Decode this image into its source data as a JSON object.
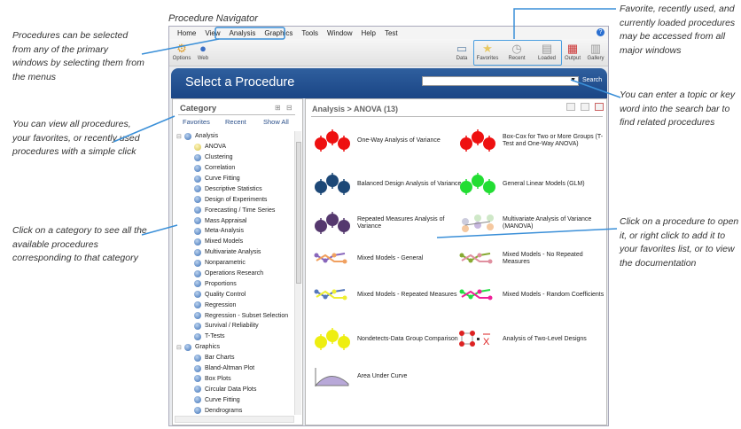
{
  "annotations": {
    "navigator_label": "Procedure Navigator",
    "menus": "Procedures can be selected from any of the primary windows by selecting them from the menus",
    "views": "You can view all procedures, your favorites, or recently used procedures with a simple click",
    "category": "Click on a category to see all the available procedures corresponding to that category",
    "favorites": "Favorite, recently used, and currently loaded procedures may be accessed from all major windows",
    "search": "You can enter a topic or key word into the search bar to find related procedures",
    "procedure": "Click on a procedure to open it, or right click to add it to your favorites list, or to view the documentation"
  },
  "menu": [
    "Home",
    "View",
    "Analysis",
    "Graphics",
    "Tools",
    "Window",
    "Help",
    "Test"
  ],
  "toolbar": {
    "options": "Options",
    "web": "Web",
    "data": "Data",
    "favorites": "Favorites",
    "recent": "Recent",
    "loaded": "Loaded",
    "output": "Output",
    "gallery": "Gallery"
  },
  "header": {
    "title": "Select a Procedure",
    "search_value": "",
    "search_button": "Search"
  },
  "category": {
    "title": "Category",
    "links": [
      "Favorites",
      "Recent",
      "Show All"
    ],
    "tree": [
      {
        "label": "Analysis",
        "level": 0
      },
      {
        "label": "ANOVA",
        "level": 1,
        "selected": true
      },
      {
        "label": "Clustering",
        "level": 1
      },
      {
        "label": "Correlation",
        "level": 1
      },
      {
        "label": "Curve Fitting",
        "level": 1
      },
      {
        "label": "Descriptive Statistics",
        "level": 1
      },
      {
        "label": "Design of Experiments",
        "level": 1
      },
      {
        "label": "Forecasting / Time Series",
        "level": 1
      },
      {
        "label": "Mass Appraisal",
        "level": 1
      },
      {
        "label": "Meta-Analysis",
        "level": 1
      },
      {
        "label": "Mixed Models",
        "level": 1
      },
      {
        "label": "Multivariate Analysis",
        "level": 1
      },
      {
        "label": "Nonparametric",
        "level": 1
      },
      {
        "label": "Operations Research",
        "level": 1
      },
      {
        "label": "Proportions",
        "level": 1
      },
      {
        "label": "Quality Control",
        "level": 1
      },
      {
        "label": "Regression",
        "level": 1
      },
      {
        "label": "Regression - Subset Selection",
        "level": 1
      },
      {
        "label": "Survival / Reliability",
        "level": 1
      },
      {
        "label": "T-Tests",
        "level": 1
      },
      {
        "label": "Graphics",
        "level": 0
      },
      {
        "label": "Bar Charts",
        "level": 1
      },
      {
        "label": "Bland-Altman Plot",
        "level": 1
      },
      {
        "label": "Box Plots",
        "level": 1
      },
      {
        "label": "Circular Data Plots",
        "level": 1
      },
      {
        "label": "Curve Fitting",
        "level": 1
      },
      {
        "label": "Dendrograms",
        "level": 1
      }
    ]
  },
  "main": {
    "breadcrumb": "Analysis > ANOVA (13)",
    "procedures": [
      {
        "label": "One-Way Analysis of Variance",
        "icon": "dots",
        "color": "#ee1111"
      },
      {
        "label": "Box-Cox for Two or More Groups (T-Test and One-Way ANOVA)",
        "icon": "dots",
        "color": "#ee1111"
      },
      {
        "label": "Balanced Design Analysis of Variance",
        "icon": "dots",
        "color": "#1d4877"
      },
      {
        "label": "General Linear Models (GLM)",
        "icon": "dots",
        "color": "#22dd33"
      },
      {
        "label": "Repeated Measures Analysis of Variance",
        "icon": "dots",
        "color": "#55386e"
      },
      {
        "label": "Multivariate Analysis of Variance (MANOVA)",
        "icon": "manova",
        "color": "#c8b8e0"
      },
      {
        "label": "Mixed Models - General",
        "icon": "lines",
        "color": "#8866bb",
        "color2": "#f0a060"
      },
      {
        "label": "Mixed Models - No Repeated Measures",
        "icon": "lines",
        "color": "#88aa33",
        "color2": "#e090a0"
      },
      {
        "label": "Mixed Models - Repeated Measures",
        "icon": "lines",
        "color": "#5577bb",
        "color2": "#eeee33"
      },
      {
        "label": "Mixed Models - Random Coefficients",
        "icon": "lines",
        "color": "#22dd44",
        "color2": "#ee2299"
      },
      {
        "label": "Nondetects-Data Group Comparison",
        "icon": "dots",
        "color": "#eeee11"
      },
      {
        "label": "Analysis of Two-Level Designs",
        "icon": "twolevel",
        "color": "#dd2222"
      },
      {
        "label": "Area Under Curve",
        "icon": "area",
        "color": "#b8a8d8"
      }
    ]
  }
}
